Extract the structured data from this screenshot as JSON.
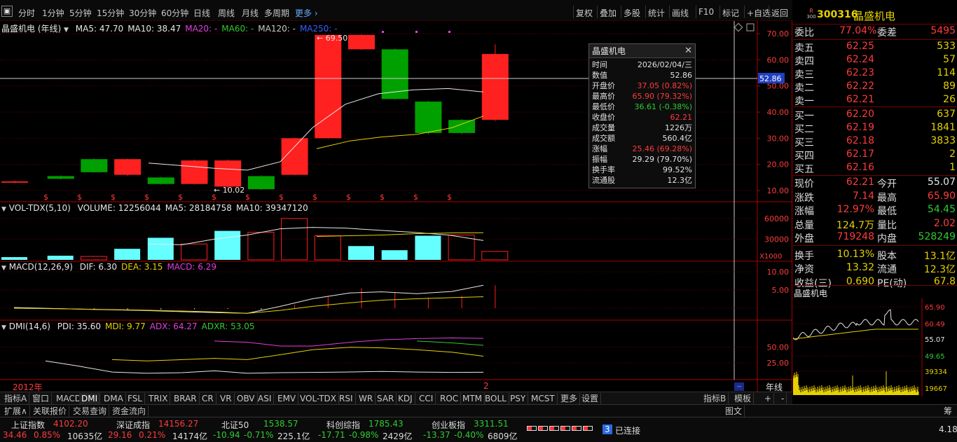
{
  "toolbar": {
    "timeframes": [
      "分时",
      "1分钟",
      "5分钟",
      "15分钟",
      "30分钟",
      "60分钟",
      "日线",
      "周线",
      "月线",
      "多周期"
    ],
    "active_timeframe": "年线",
    "more_label": "更多",
    "buttons": [
      "复权",
      "叠加",
      "多股",
      "统计",
      "画线",
      "F10",
      "标记",
      "+自选",
      "返回"
    ]
  },
  "main_chart": {
    "title": "晶盛机电 (年线)",
    "ma_labels": [
      {
        "text": "MA5: 47.70",
        "color": "#e8e8e8"
      },
      {
        "text": "MA10: 38.47",
        "color": "#e8e8e8"
      },
      {
        "text": "MA20: -",
        "color": "#e040e0"
      },
      {
        "text": "MA60: -",
        "color": "#2ecc2e"
      },
      {
        "text": "MA120: -",
        "color": "#c8c8c8"
      },
      {
        "text": "MA250: -",
        "color": "#3060ff"
      }
    ],
    "y_ticks": [
      "70.00",
      "60.00",
      "50.00",
      "40.00",
      "30.00",
      "20.00",
      "10.00"
    ],
    "current_price_label": "52.86",
    "high_marker": "69.50",
    "low_marker": "10.02",
    "candles": [
      {
        "open": 13.0,
        "close": 13.5,
        "high": 13.8,
        "low": 12.8,
        "up": true
      },
      {
        "open": 14.5,
        "close": 15.5,
        "high": 15.8,
        "low": 14.2,
        "up": false
      },
      {
        "open": 22.0,
        "close": 17.0,
        "high": 22.2,
        "low": 16.8,
        "up": false
      },
      {
        "open": 22.0,
        "close": 16.0,
        "high": 22.2,
        "low": 15.6,
        "up": true
      },
      {
        "open": 15.0,
        "close": 12.5,
        "high": 15.2,
        "low": 12.3,
        "up": false
      },
      {
        "open": 12.5,
        "close": 21.5,
        "high": 21.8,
        "low": 12.3,
        "up": true
      },
      {
        "open": 11.5,
        "close": 21.5,
        "high": 21.8,
        "low": 10.02,
        "up": true
      },
      {
        "open": 15.5,
        "close": 10.5,
        "high": 15.8,
        "low": 10.3,
        "up": false
      },
      {
        "open": 16.0,
        "close": 30.0,
        "high": 30.2,
        "low": 15.8,
        "up": true
      },
      {
        "open": 30.0,
        "close": 69.5,
        "high": 69.5,
        "low": 29.8,
        "up": true
      },
      {
        "open": 64.0,
        "close": 69.5,
        "high": 69.8,
        "low": 63.8,
        "up": true
      },
      {
        "open": 64.0,
        "close": 45.0,
        "high": 64.3,
        "low": 44.8,
        "up": false
      },
      {
        "open": 44.0,
        "close": 32.0,
        "high": 44.3,
        "low": 31.5,
        "up": false
      },
      {
        "open": 37.0,
        "close": 32.0,
        "high": 37.3,
        "low": 31.5,
        "up": false
      },
      {
        "open": 37.05,
        "close": 62.21,
        "high": 65.9,
        "low": 36.61,
        "up": true
      }
    ],
    "ma5_points": [
      [
        212,
        20.5
      ],
      [
        260,
        19.5
      ],
      [
        306,
        18.5
      ],
      [
        353,
        17.8
      ],
      [
        400,
        21.0
      ],
      [
        446,
        34.0
      ],
      [
        493,
        43.0
      ],
      [
        540,
        47.0
      ],
      [
        590,
        48.5
      ],
      [
        640,
        49.0
      ],
      [
        690,
        47.7
      ]
    ],
    "ma10_points": [
      [
        452,
        26.0
      ],
      [
        500,
        29.0
      ],
      [
        545,
        30.5
      ],
      [
        595,
        31.5
      ],
      [
        645,
        34.0
      ],
      [
        690,
        38.47
      ]
    ],
    "dividend_marks": [
      "$",
      "$",
      "$",
      "$",
      "$",
      "$",
      "$",
      "$",
      "$",
      "$",
      "$",
      "$",
      "$"
    ]
  },
  "tooltip": {
    "title": "晶盛机电",
    "rows": [
      {
        "k": "时间",
        "v": "2026/02/04/三",
        "c": "#e0e0e0"
      },
      {
        "k": "数值",
        "v": "52.86",
        "c": "#e0e0e0"
      },
      {
        "k": "开盘价",
        "v": "37.05 (0.82%)",
        "c": "#ff3b3b"
      },
      {
        "k": "最高价",
        "v": "65.90 (79.32%)",
        "c": "#ff3b3b"
      },
      {
        "k": "最低价",
        "v": "36.61 (-0.38%)",
        "c": "#2ecc2e"
      },
      {
        "k": "收盘价",
        "v": "62.21",
        "c": "#ff3b3b"
      },
      {
        "k": "成交量",
        "v": "1226万",
        "c": "#e0e0e0"
      },
      {
        "k": "成交额",
        "v": "560.4亿",
        "c": "#e0e0e0"
      },
      {
        "k": "涨幅",
        "v": "25.46 (69.28%)",
        "c": "#ff3b3b"
      },
      {
        "k": "振幅",
        "v": "29.29 (79.70%)",
        "c": "#e0e0e0"
      },
      {
        "k": "换手率",
        "v": "99.52%",
        "c": "#e0e0e0"
      },
      {
        "k": "流通股",
        "v": "12.3亿",
        "c": "#e0e0e0"
      }
    ]
  },
  "volume_panel": {
    "title": "VOL-TDX(5,10)",
    "labels": [
      {
        "text": "VOLUME: 12256044",
        "color": "#e8e8e8"
      },
      {
        "text": "MA5: 28184758",
        "color": "#e8e8e8"
      },
      {
        "text": "MA10: 39347120",
        "color": "#e8e8e8"
      }
    ],
    "y_ticks": [
      "60000",
      "30000"
    ],
    "unit": "X1000",
    "bars": [
      {
        "v": 4000,
        "up": false
      },
      {
        "v": 6000,
        "up": false
      },
      {
        "v": 5000,
        "up": true
      },
      {
        "v": 16000,
        "up": false
      },
      {
        "v": 32000,
        "up": false
      },
      {
        "v": 23000,
        "up": true
      },
      {
        "v": 42000,
        "up": false
      },
      {
        "v": 40000,
        "up": true
      },
      {
        "v": 60000,
        "up": true
      },
      {
        "v": 35000,
        "up": true
      },
      {
        "v": 20000,
        "up": false
      },
      {
        "v": 14000,
        "up": false
      },
      {
        "v": 35000,
        "up": false
      },
      {
        "v": 36000,
        "up": true
      },
      {
        "v": 12256,
        "up": true
      }
    ]
  },
  "macd_panel": {
    "title": "MACD(12,26,9)",
    "labels": [
      {
        "text": "DIF: 6.30",
        "color": "#e8e8e8"
      },
      {
        "text": "DEA: 3.15",
        "color": "#e6d200"
      },
      {
        "text": "MACD: 6.29",
        "color": "#e040e0"
      }
    ],
    "y_ticks": [
      "10.00",
      "5.00"
    ]
  },
  "dmi_panel": {
    "title": "DMI(14,6)",
    "labels": [
      {
        "text": "PDI: 35.60",
        "color": "#e8e8e8"
      },
      {
        "text": "MDI: 9.77",
        "color": "#e6d200"
      },
      {
        "text": "ADX: 64.27",
        "color": "#e040e0"
      },
      {
        "text": "ADXR: 53.05",
        "color": "#2ecc2e"
      }
    ],
    "y_ticks": [
      "50.00",
      "25.00"
    ],
    "year_label": "2012年",
    "year_marker": "2",
    "period_label": "年线"
  },
  "tabs": {
    "left_label": "指标A",
    "items": [
      "窗口",
      "MACD",
      "DMI",
      "DMA",
      "FSL",
      "TRIX",
      "BRAR",
      "CR",
      "VR",
      "OBV",
      "ASI",
      "EMV",
      "VOL-TDX",
      "RSI",
      "WR",
      "SAR",
      "KDJ",
      "CCI",
      "ROC",
      "MTM",
      "BOLL",
      "PSY",
      "MCST",
      "更多",
      "设置"
    ],
    "active": "DMI",
    "right_items": [
      "指标B",
      "模板"
    ]
  },
  "bottom1": {
    "items": [
      "扩展∧",
      "关联报价",
      "交易查询",
      "资金流向"
    ],
    "right_items": [
      "图文",
      "筹"
    ]
  },
  "indices": [
    {
      "name": "上证指数",
      "value": "4102.20",
      "chg": "34.46",
      "pct": "0.85%",
      "amt": "10635亿",
      "up": true
    },
    {
      "name": "深证成指",
      "value": "14156.27",
      "chg": "29.16",
      "pct": "0.21%",
      "amt": "14174亿",
      "up": true
    },
    {
      "name": "北证50",
      "value": "1538.57",
      "chg": "-10.94",
      "pct": "-0.71%",
      "amt": "225.1亿",
      "up": false
    },
    {
      "name": "科创综指",
      "value": "1785.43",
      "chg": "-17.71",
      "pct": "-0.98%",
      "amt": "2429亿",
      "up": false
    },
    {
      "name": "创业板指",
      "value": "3311.51",
      "chg": "-13.37",
      "pct": "-0.40%",
      "amt": "6809亿",
      "up": false
    }
  ],
  "connection": {
    "count": "3",
    "label": "已连接",
    "time_fragment": "4.18"
  },
  "quote": {
    "badge_top": "R",
    "badge_bottom": "300",
    "code": "300316",
    "name": "晶盛机电",
    "weibi_label": "委比",
    "weibi": "77.04%",
    "weicha_label": "委差",
    "weicha": "5495",
    "asks": [
      {
        "label": "卖五",
        "price": "62.25",
        "vol": "533"
      },
      {
        "label": "卖四",
        "price": "62.24",
        "vol": "57"
      },
      {
        "label": "卖三",
        "price": "62.23",
        "vol": "114"
      },
      {
        "label": "卖二",
        "price": "62.22",
        "vol": "89"
      },
      {
        "label": "卖一",
        "price": "62.21",
        "vol": "26"
      }
    ],
    "bids": [
      {
        "label": "买一",
        "price": "62.20",
        "vol": "637"
      },
      {
        "label": "买二",
        "price": "62.19",
        "vol": "1841"
      },
      {
        "label": "买三",
        "price": "62.18",
        "vol": "3833"
      },
      {
        "label": "买四",
        "price": "62.17",
        "vol": "2"
      },
      {
        "label": "买五",
        "price": "62.16",
        "vol": "1"
      }
    ],
    "stats": [
      {
        "l1": "现价",
        "v1": "62.21",
        "c1": "#ff3b3b",
        "l2": "今开",
        "v2": "55.07",
        "c2": "#e6e6e6"
      },
      {
        "l1": "涨跌",
        "v1": "7.14",
        "c1": "#ff3b3b",
        "l2": "最高",
        "v2": "65.90",
        "c2": "#ff3b3b"
      },
      {
        "l1": "涨幅",
        "v1": "12.97%",
        "c1": "#ff3b3b",
        "l2": "最低",
        "v2": "54.45",
        "c2": "#2ecc2e"
      },
      {
        "l1": "总量",
        "v1": "124.7万",
        "c1": "#e6d200",
        "l2": "量比",
        "v2": "2.02",
        "c2": "#ff3b3b"
      },
      {
        "l1": "外盘",
        "v1": "719248",
        "c1": "#ff3b3b",
        "l2": "内盘",
        "v2": "528249",
        "c2": "#2ecc2e"
      },
      {
        "l1": "换手",
        "v1": "10.13%",
        "c1": "#e6d200",
        "l2": "股本",
        "v2": "13.1亿",
        "c2": "#e6d200"
      },
      {
        "l1": "净资",
        "v1": "13.32",
        "c1": "#e6d200",
        "l2": "流通",
        "v2": "12.3亿",
        "c2": "#e6d200"
      },
      {
        "l1": "收益(三)",
        "v1": "0.690",
        "c1": "#e6d200",
        "l2": "PE(动)",
        "v2": "67.8",
        "c2": "#e6d200"
      }
    ],
    "mini_title": "晶盛机电",
    "mini_ticks": [
      "65.90",
      "60.49",
      "55.07",
      "49.65",
      "39334",
      "19667"
    ]
  },
  "colors": {
    "up": "#ff2020",
    "down": "#00a000",
    "grid": "#7a0000",
    "cyan": "#66ffff"
  }
}
